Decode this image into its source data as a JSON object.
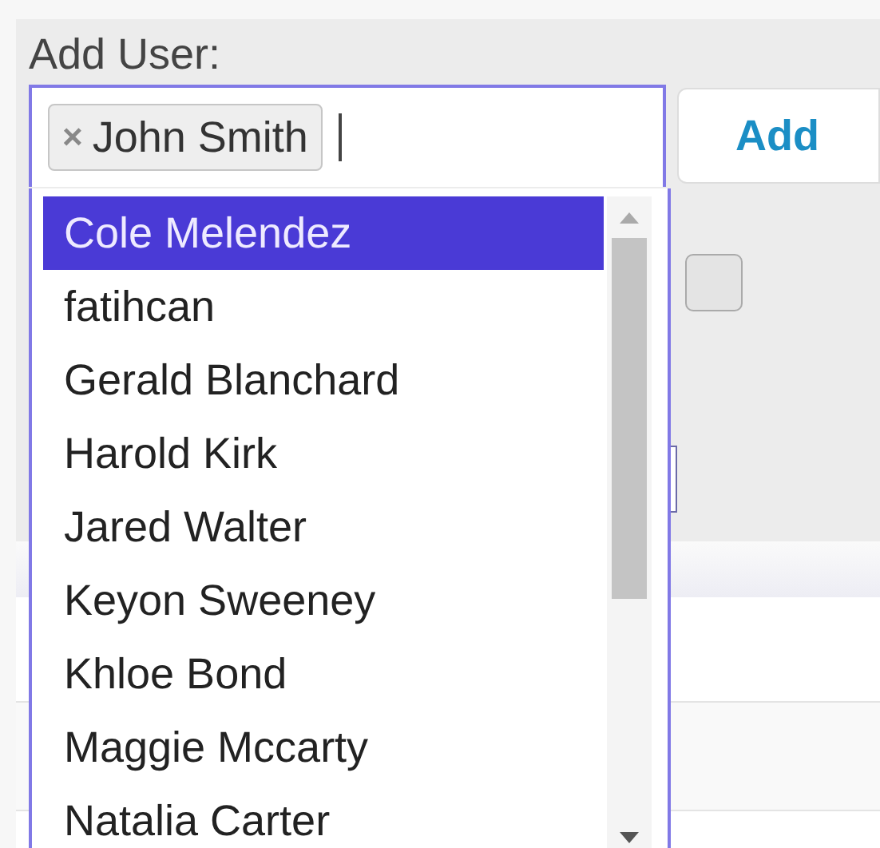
{
  "field": {
    "label": "Add User:",
    "tokens": [
      {
        "remove": "×",
        "text": "John Smith"
      }
    ]
  },
  "add_button": {
    "label": "Add"
  },
  "dropdown": {
    "options": [
      {
        "text": "Cole Melendez",
        "selected": true
      },
      {
        "text": "fatihcan",
        "selected": false
      },
      {
        "text": "Gerald Blanchard",
        "selected": false
      },
      {
        "text": "Harold Kirk",
        "selected": false
      },
      {
        "text": "Jared Walter",
        "selected": false
      },
      {
        "text": "Keyon Sweeney",
        "selected": false
      },
      {
        "text": "Khloe Bond",
        "selected": false
      },
      {
        "text": "Maggie Mccarty",
        "selected": false
      },
      {
        "text": "Natalia Carter",
        "selected": false
      }
    ]
  },
  "background": {
    "checkbox": {
      "checked": false
    }
  }
}
